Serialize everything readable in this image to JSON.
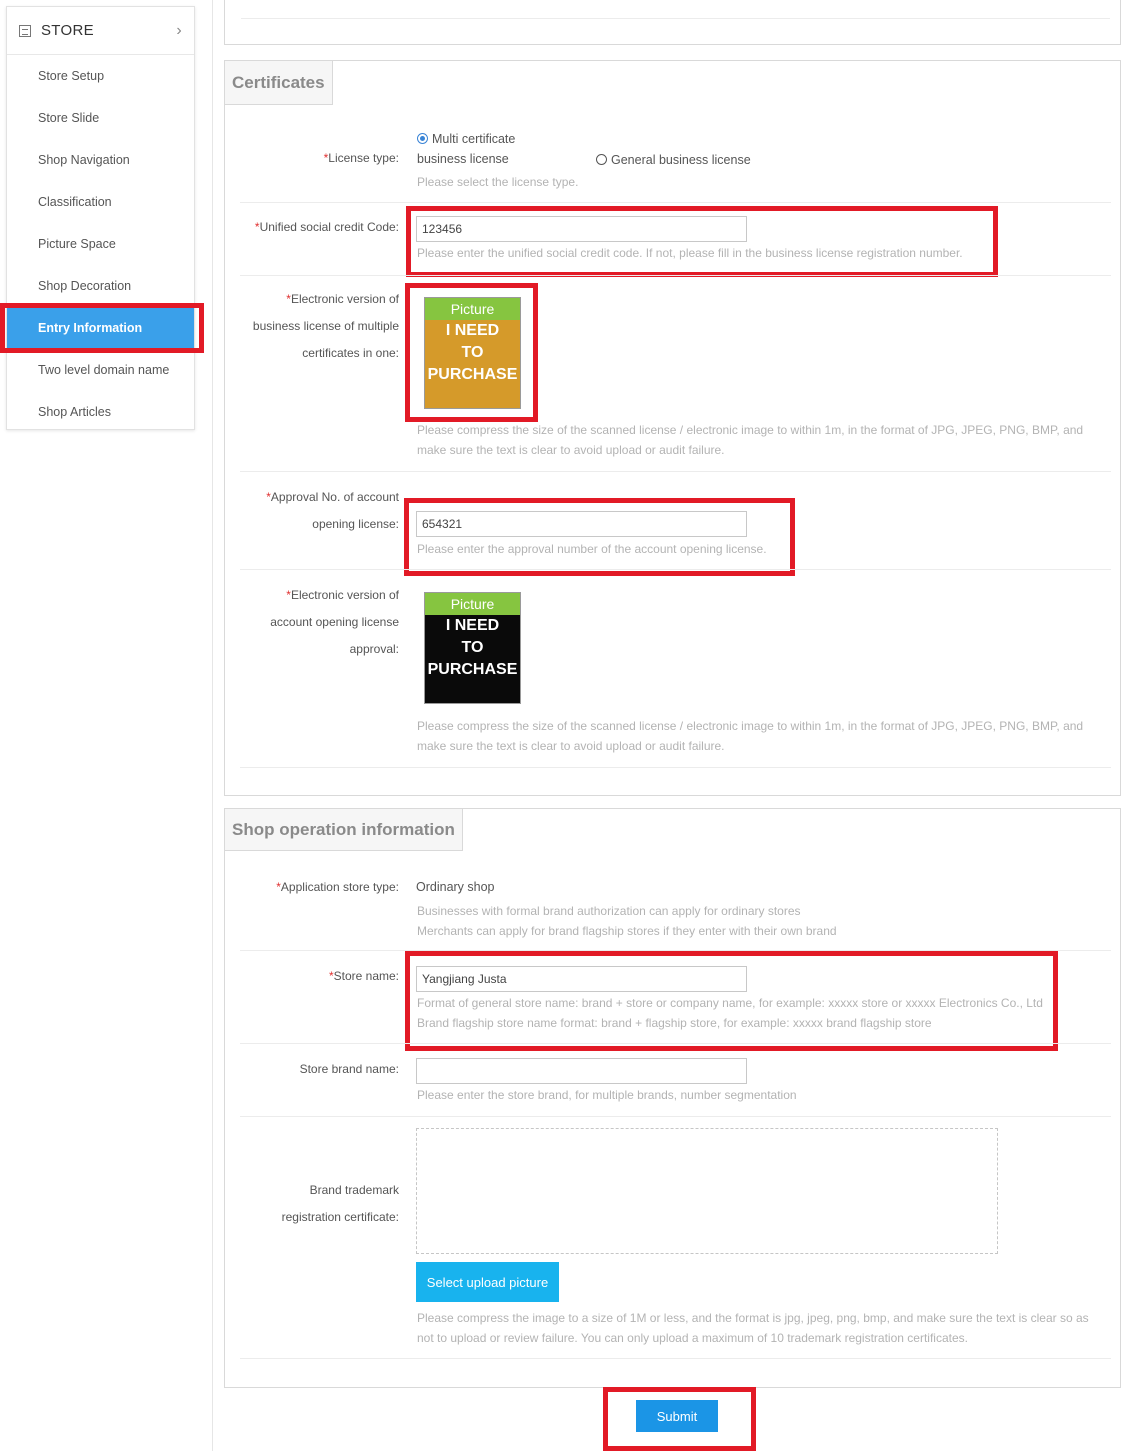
{
  "sidebar": {
    "title": "STORE",
    "items": [
      {
        "label": "Store Setup"
      },
      {
        "label": "Store Slide"
      },
      {
        "label": "Shop Navigation"
      },
      {
        "label": "Classification"
      },
      {
        "label": "Picture Space"
      },
      {
        "label": "Shop Decoration"
      },
      {
        "label": "Entry Information",
        "active": true
      },
      {
        "label": "Two level domain name"
      },
      {
        "label": "Shop Articles"
      }
    ]
  },
  "certificates": {
    "tab": "Certificates",
    "license_type": {
      "label": "License type:",
      "option_multi_line1": "Multi certificate",
      "option_multi_line2": "business license",
      "option_general": "General business license",
      "selected": "Multi certificate business license",
      "hint": "Please select the license type."
    },
    "credit_code": {
      "label": "Unified social credit Code:",
      "value": "123456",
      "hint": "Please enter the unified social credit code. If not, please fill in the business license registration number."
    },
    "business_license_image": {
      "label_line1": "Electronic version of",
      "label_line2": "business license of multiple",
      "label_line3": "certificates in one:",
      "pic_header": "Picture",
      "pic_line1": "I NEED",
      "pic_line2": "TO",
      "pic_line3": "PURCHASE",
      "hint_line1": "Please compress the size of the scanned license / electronic image to within 1m, in the format of JPG, JPEG, PNG, BMP, and",
      "hint_line2": "make sure the text is clear to avoid upload or audit failure."
    },
    "approval_no": {
      "label_line1": "Approval No. of account",
      "label_line2": "opening license:",
      "value": "654321",
      "hint": "Please enter the approval number of the account opening license."
    },
    "approval_image": {
      "label_line1": "Electronic version of",
      "label_line2": "account opening license",
      "label_line3": "approval:",
      "pic_header": "Picture",
      "pic_line1": "I NEED",
      "pic_line2": "TO",
      "pic_line3": "PURCHASE",
      "hint_line1": "Please compress the size of the scanned license / electronic image to within 1m, in the format of JPG, JPEG, PNG, BMP, and",
      "hint_line2": "make sure the text is clear to avoid upload or audit failure."
    }
  },
  "shop_operation": {
    "tab": "Shop operation information",
    "store_type": {
      "label": "Application store type:",
      "value": "Ordinary shop",
      "hint_line1": "Businesses with formal brand authorization can apply for ordinary stores",
      "hint_line2": "Merchants can apply for brand flagship stores if they enter with their own brand"
    },
    "store_name": {
      "label": "Store name:",
      "value": "Yangjiang Justa",
      "hint_line1": "Format of general store name: brand + store or company name, for example: xxxxx store or xxxxx Electronics Co., Ltd",
      "hint_line2": "Brand flagship store name format: brand + flagship store, for example: xxxxx brand flagship store"
    },
    "brand_name": {
      "label": "Store brand name:",
      "value": "",
      "hint": "Please enter the store brand, for multiple brands, number segmentation"
    },
    "trademark": {
      "label_line1": "Brand trademark",
      "label_line2": "registration certificate:",
      "upload_button": "Select upload picture",
      "hint_line1": "Please compress the image to a size of 1M or less, and the format is jpg, jpeg, png, bmp, and make sure the text is clear so as",
      "hint_line2": "not to upload or review failure. You can only upload a maximum of 10 trademark registration certificates."
    }
  },
  "submit_label": "Submit",
  "colors": {
    "accent": "#3aa0ea",
    "highlight": "#e21a26",
    "required": "#e03030",
    "upload_button": "#18b3ee"
  }
}
